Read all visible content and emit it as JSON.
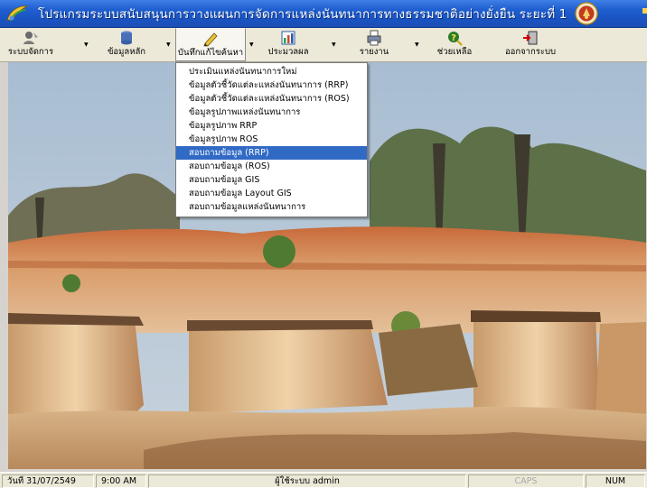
{
  "window": {
    "title": "โปรแกรมระบบสนับสนุนการวางแผนการจัดการแหล่งนันทนาการทางธรรมชาติอย่างยั่งยืน ระยะที่ 1",
    "app_icon": "leaf-swirl-icon",
    "logo_icon": "seal-logo-icon",
    "title_bar_color": "#1f5fd0"
  },
  "toolbar": {
    "items": [
      {
        "label": "ระบบจัดการ",
        "icon": "admin-tools-icon",
        "has_dropdown": true
      },
      {
        "label": "ข้อมูลหลัก",
        "icon": "database-icon",
        "has_dropdown": true
      },
      {
        "label": "บันทึกแก้ไขค้นหา",
        "icon": "edit-search-icon",
        "has_dropdown": true,
        "active": true
      },
      {
        "label": "ประมวลผล",
        "icon": "process-chart-icon",
        "has_dropdown": true
      },
      {
        "label": "รายงาน",
        "icon": "printer-icon",
        "has_dropdown": true
      },
      {
        "label": "ช่วยเหลือ",
        "icon": "help-icon",
        "has_dropdown": false
      },
      {
        "label": "ออกจากระบบ",
        "icon": "exit-icon",
        "has_dropdown": false
      }
    ]
  },
  "menu": {
    "items": [
      "ประเมินแหล่งนันทนาการใหม่",
      "ข้อมูลตัวชี้วัดแต่ละแหล่งนันทนาการ (RRP)",
      "ข้อมูลตัวชี้วัดแต่ละแหล่งนันทนาการ (ROS)",
      "ข้อมูลรูปภาพแหล่งนันทนาการ",
      "ข้อมูลรูปภาพ RRP",
      "ข้อมูลรูปภาพ ROS",
      "สอบถามข้อมูล (RRP)",
      "สอบถามข้อมูล (ROS)",
      "สอบถามข้อมูล GIS",
      "สอบถามข้อมูล Layout GIS",
      "สอบถามข้อมูลแหล่งนันทนาการ"
    ],
    "selected_index": 6,
    "highlight_color": "#316ac5"
  },
  "statusbar": {
    "date": "วันที่ 31/07/2549",
    "time": "9:00 AM",
    "user": "ผู้ใช้ระบบ admin",
    "caps": "CAPS",
    "num": "NUM"
  }
}
